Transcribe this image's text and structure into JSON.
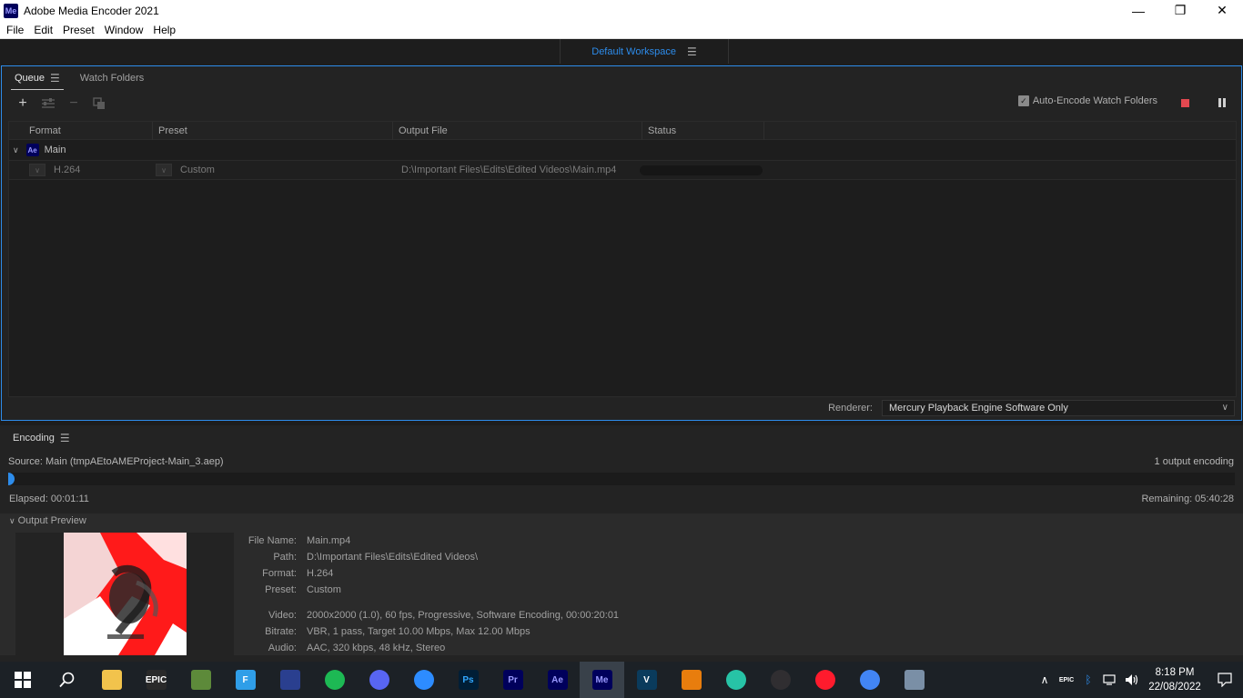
{
  "window": {
    "app_icon": "Me",
    "title": "Adobe Media Encoder 2021",
    "minimize": "—",
    "maximize": "❐",
    "close": "✕"
  },
  "menu": {
    "items": [
      "File",
      "Edit",
      "Preset",
      "Window",
      "Help"
    ]
  },
  "workspace": {
    "label": "Default Workspace"
  },
  "queue": {
    "tabs": [
      "Queue",
      "Watch Folders"
    ],
    "auto_encode_label": "Auto-Encode Watch Folders",
    "auto_encode_checked": true,
    "columns": [
      "Format",
      "Preset",
      "Output File",
      "Status"
    ],
    "group": {
      "badge": "Ae",
      "name": "Main"
    },
    "output": {
      "format": "H.264",
      "preset": "Custom",
      "output_file": "D:\\Important Files\\Edits\\Edited Videos\\Main.mp4"
    },
    "renderer_label": "Renderer:",
    "renderer_value": "Mercury Playback Engine Software Only"
  },
  "encoding": {
    "tab_label": "Encoding",
    "source": "Source: Main (tmpAEtoAMEProject-Main_3.aep)",
    "output_count": "1 output encoding",
    "progress": 0.003,
    "elapsed": "Elapsed: 00:01:11",
    "remaining": "Remaining: 05:40:28",
    "preview_label": "Output Preview",
    "info": {
      "file_name_label": "File Name:",
      "file_name": "Main.mp4",
      "path_label": "Path:",
      "path": "D:\\Important Files\\Edits\\Edited Videos\\",
      "format_label": "Format:",
      "format": "H.264",
      "preset_label": "Preset:",
      "preset": "Custom",
      "video_label": "Video:",
      "video": "2000x2000 (1.0), 60 fps, Progressive, Software Encoding, 00:00:20:01",
      "bitrate_label": "Bitrate:",
      "bitrate": "VBR, 1 pass, Target 10.00 Mbps, Max 12.00 Mbps",
      "audio_label": "Audio:",
      "audio": "AAC, 320 kbps, 48 kHz, Stereo"
    }
  },
  "taskbar": {
    "apps": [
      {
        "name": "file-explorer-icon",
        "label": "",
        "color": "#f2c34c"
      },
      {
        "name": "epic-games-icon",
        "label": "EPIC",
        "color": "#2a2a2a"
      },
      {
        "name": "minecraft-icon",
        "label": "",
        "color": "#5d8a3a"
      },
      {
        "name": "fortnite-icon",
        "label": "F",
        "color": "#2f9ee8"
      },
      {
        "name": "game-icon",
        "label": "",
        "color": "#2a3f8f"
      },
      {
        "name": "spotify-icon",
        "label": "",
        "color": "#1db954"
      },
      {
        "name": "discord-icon",
        "label": "",
        "color": "#5865f2"
      },
      {
        "name": "zoom-icon",
        "label": "",
        "color": "#2d8cff"
      },
      {
        "name": "photoshop-icon",
        "label": "Ps",
        "color": "#001e36"
      },
      {
        "name": "premiere-icon",
        "label": "Pr",
        "color": "#00005b"
      },
      {
        "name": "after-effects-icon",
        "label": "Ae",
        "color": "#00005b"
      },
      {
        "name": "media-encoder-icon",
        "label": "Me",
        "color": "#00005b"
      },
      {
        "name": "vegas-icon",
        "label": "V",
        "color": "#0a3b5c"
      },
      {
        "name": "blender-icon",
        "label": "",
        "color": "#e87d0d"
      },
      {
        "name": "bandicam-icon",
        "label": "",
        "color": "#27c3a6"
      },
      {
        "name": "obs-icon",
        "label": "",
        "color": "#302e31"
      },
      {
        "name": "opera-icon",
        "label": "",
        "color": "#ff1b2d"
      },
      {
        "name": "chrome-icon",
        "label": "",
        "color": "#4285f4"
      },
      {
        "name": "control-panel-icon",
        "label": "",
        "color": "#7a8fa6"
      }
    ],
    "time": "8:18 PM",
    "date": "22/08/2022",
    "tray_epic_label": "EPIC"
  }
}
